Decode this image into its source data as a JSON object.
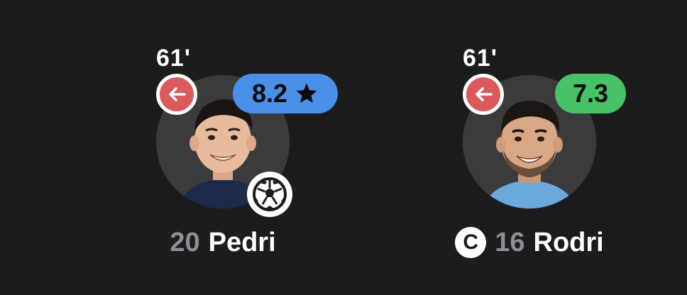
{
  "players": [
    {
      "number": "20",
      "name": "Pedri",
      "sub_time": "61'",
      "rating": "8.2",
      "rating_color": "#4a90e8",
      "top_rated": true,
      "scored_goal": true,
      "captain": false,
      "sub_icon": "arrow-left-icon",
      "sub_color": "#d95a5a"
    },
    {
      "number": "16",
      "name": "Rodri",
      "sub_time": "61'",
      "rating": "7.3",
      "rating_color": "#47c266",
      "top_rated": false,
      "scored_goal": false,
      "captain": true,
      "captain_label": "C",
      "sub_icon": "arrow-left-icon",
      "sub_color": "#d95a5a"
    }
  ],
  "icons": {
    "rating_star": "star-icon",
    "goal": "soccer-ball-icon",
    "captain": "captain-icon"
  }
}
